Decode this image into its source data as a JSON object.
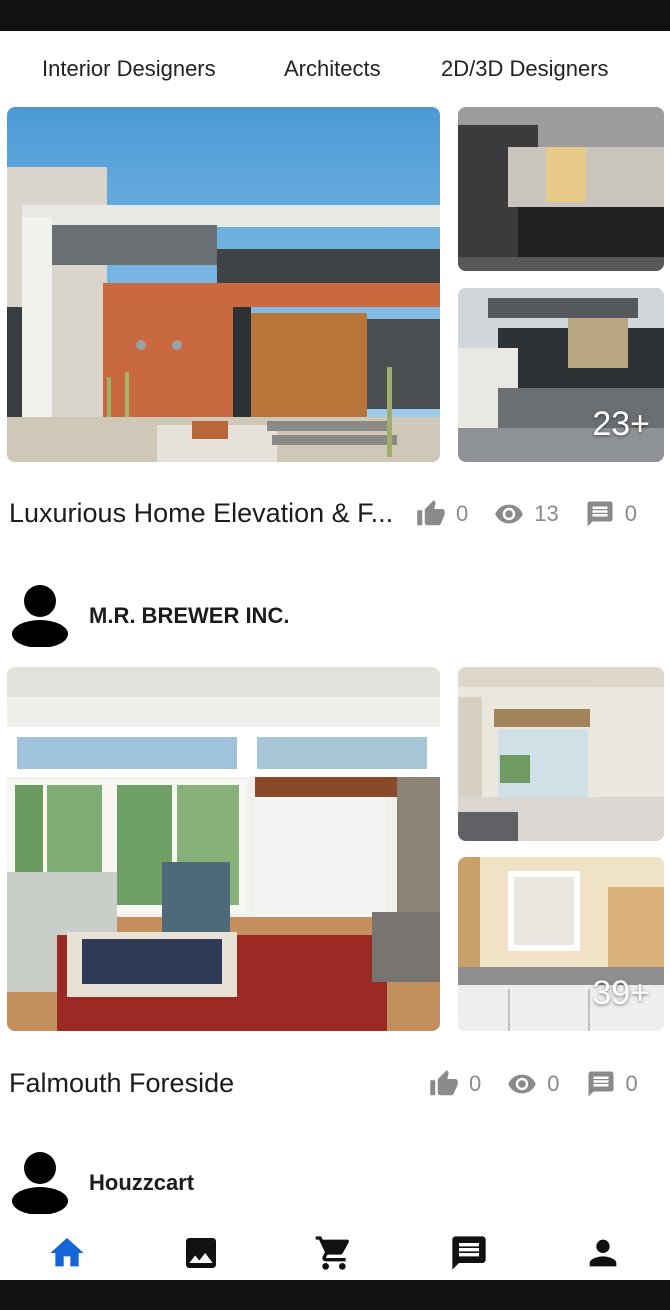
{
  "tabs": [
    {
      "label": "Interior Designers"
    },
    {
      "label": "Architects"
    },
    {
      "label": "2D/3D Designers"
    }
  ],
  "projects": [
    {
      "title": "Luxurious Home Elevation & F...",
      "photos": [
        "modern-house-exterior-main",
        "modern-house-exterior-dusk",
        "modern-house-exterior-side"
      ],
      "more_photos": "23+",
      "likes": "0",
      "views": "13",
      "comments": "0"
    },
    {
      "title": "Falmouth Foreside",
      "photos": [
        "living-room-interior-main",
        "bathroom-vanity-window",
        "bathroom-mirror-sink"
      ],
      "more_photos": "39+",
      "likes": "0",
      "views": "0",
      "comments": "0"
    }
  ],
  "users": [
    {
      "name": "M.R. BREWER INC."
    },
    {
      "name": "Houzzcart"
    }
  ],
  "bottom_nav": [
    {
      "icon": "home-icon",
      "active": true
    },
    {
      "icon": "image-icon",
      "active": false
    },
    {
      "icon": "cart-icon",
      "active": false
    },
    {
      "icon": "chat-icon",
      "active": false
    },
    {
      "icon": "person-icon",
      "active": false
    }
  ],
  "colors": {
    "active": "#1565d8",
    "icon": "#111111",
    "stat": "#8a8a8a",
    "system_bar": "#111111"
  }
}
